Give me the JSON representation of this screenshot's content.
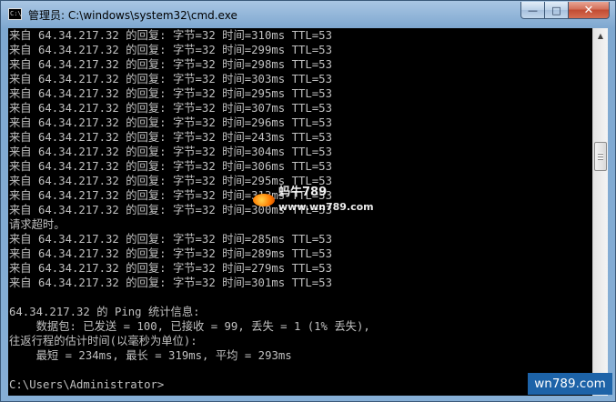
{
  "window": {
    "title": "管理员: C:\\windows\\system32\\cmd.exe",
    "icon": "cmd-icon",
    "controls": {
      "minimize": "—",
      "maximize": "□",
      "close": "✕"
    }
  },
  "console": {
    "lines": [
      "来自 64.34.217.32 的回复: 字节=32 时间=310ms TTL=53",
      "来自 64.34.217.32 的回复: 字节=32 时间=299ms TTL=53",
      "来自 64.34.217.32 的回复: 字节=32 时间=298ms TTL=53",
      "来自 64.34.217.32 的回复: 字节=32 时间=303ms TTL=53",
      "来自 64.34.217.32 的回复: 字节=32 时间=295ms TTL=53",
      "来自 64.34.217.32 的回复: 字节=32 时间=307ms TTL=53",
      "来自 64.34.217.32 的回复: 字节=32 时间=296ms TTL=53",
      "来自 64.34.217.32 的回复: 字节=32 时间=243ms TTL=53",
      "来自 64.34.217.32 的回复: 字节=32 时间=304ms TTL=53",
      "来自 64.34.217.32 的回复: 字节=32 时间=306ms TTL=53",
      "来自 64.34.217.32 的回复: 字节=32 时间=295ms TTL=53",
      "来自 64.34.217.32 的回复: 字节=32 时间=313ms TTL=53",
      "来自 64.34.217.32 的回复: 字节=32 时间=300ms TTL=53",
      "请求超时。",
      "来自 64.34.217.32 的回复: 字节=32 时间=285ms TTL=53",
      "来自 64.34.217.32 的回复: 字节=32 时间=289ms TTL=53",
      "来自 64.34.217.32 的回复: 字节=32 时间=279ms TTL=53",
      "来自 64.34.217.32 的回复: 字节=32 时间=301ms TTL=53",
      "",
      "64.34.217.32 的 Ping 统计信息:",
      "    数据包: 已发送 = 100, 已接收 = 99, 丢失 = 1 (1% 丢失),",
      "往返行程的估计时间(以毫秒为单位):",
      "    最短 = 234ms, 最长 = 319ms, 平均 = 293ms",
      "",
      "C:\\Users\\Administrator>"
    ]
  },
  "watermarks": {
    "center_line1": "蚂牛789",
    "center_line2": "www.wn789.com",
    "corner": "wn789.com"
  },
  "scrollbar": {
    "up_glyph": "▲",
    "down_glyph": "▼",
    "position": 0.32
  }
}
